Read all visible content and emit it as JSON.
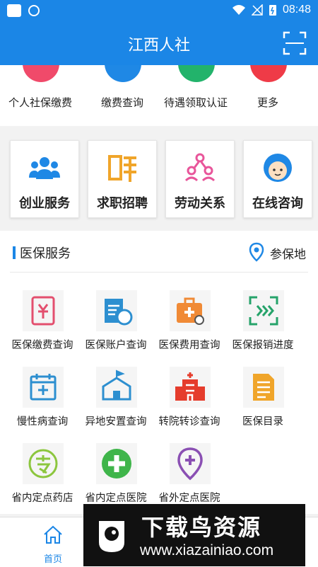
{
  "status_bar": {
    "time": "08:48"
  },
  "app_bar": {
    "title": "江西人社"
  },
  "top_row": [
    {
      "label": "个人社保缴费",
      "icon": "wallet-icon",
      "color": "#f04a6a"
    },
    {
      "label": "缴费查询",
      "icon": "search-icon",
      "color": "#1f88e5"
    },
    {
      "label": "待遇领取认证",
      "icon": "certification-icon",
      "color": "#22b36b"
    },
    {
      "label": "更多",
      "icon": "more-icon",
      "color": "#ef3b47"
    }
  ],
  "service_cards": [
    {
      "label": "创业服务",
      "icon": "business-people-icon"
    },
    {
      "label": "求职招聘",
      "icon": "recruit-icon"
    },
    {
      "label": "劳动关系",
      "icon": "labor-relation-icon"
    },
    {
      "label": "在线咨询",
      "icon": "customer-service-icon"
    }
  ],
  "medical": {
    "title": "医保服务",
    "location_label": "参保地",
    "items": [
      {
        "label": "医保缴费查询",
        "icon": "payment-query-icon",
        "color": "#e34f6e"
      },
      {
        "label": "医保账户查询",
        "icon": "account-query-icon",
        "color": "#2d8fd0"
      },
      {
        "label": "医保费用查询",
        "icon": "medical-kit-icon",
        "color": "#f08a36"
      },
      {
        "label": "医保报销进度",
        "icon": "progress-scan-icon",
        "color": "#26a36a"
      },
      {
        "label": "慢性病查询",
        "icon": "calendar-icon",
        "color": "#2d8fd0"
      },
      {
        "label": "异地安置查询",
        "icon": "relocation-icon",
        "color": "#2d8fd0"
      },
      {
        "label": "转院转诊查询",
        "icon": "hospital-icon",
        "color": "#e53c2c"
      },
      {
        "label": "医保目录",
        "icon": "document-icon",
        "color": "#f0a52a"
      },
      {
        "label": "省内定点药店",
        "icon": "pharmacy-icon",
        "color": "#8cc63e"
      },
      {
        "label": "省内定点医院",
        "icon": "hospital-cross-icon",
        "color": "#3fb54a"
      },
      {
        "label": "省外定点医院",
        "icon": "location-cross-icon",
        "color": "#8a4fb3"
      }
    ]
  },
  "tab_bar": {
    "home_label": "首页"
  },
  "watermark": {
    "title": "下载鸟资源",
    "url": "www.xiazainiao.com"
  }
}
